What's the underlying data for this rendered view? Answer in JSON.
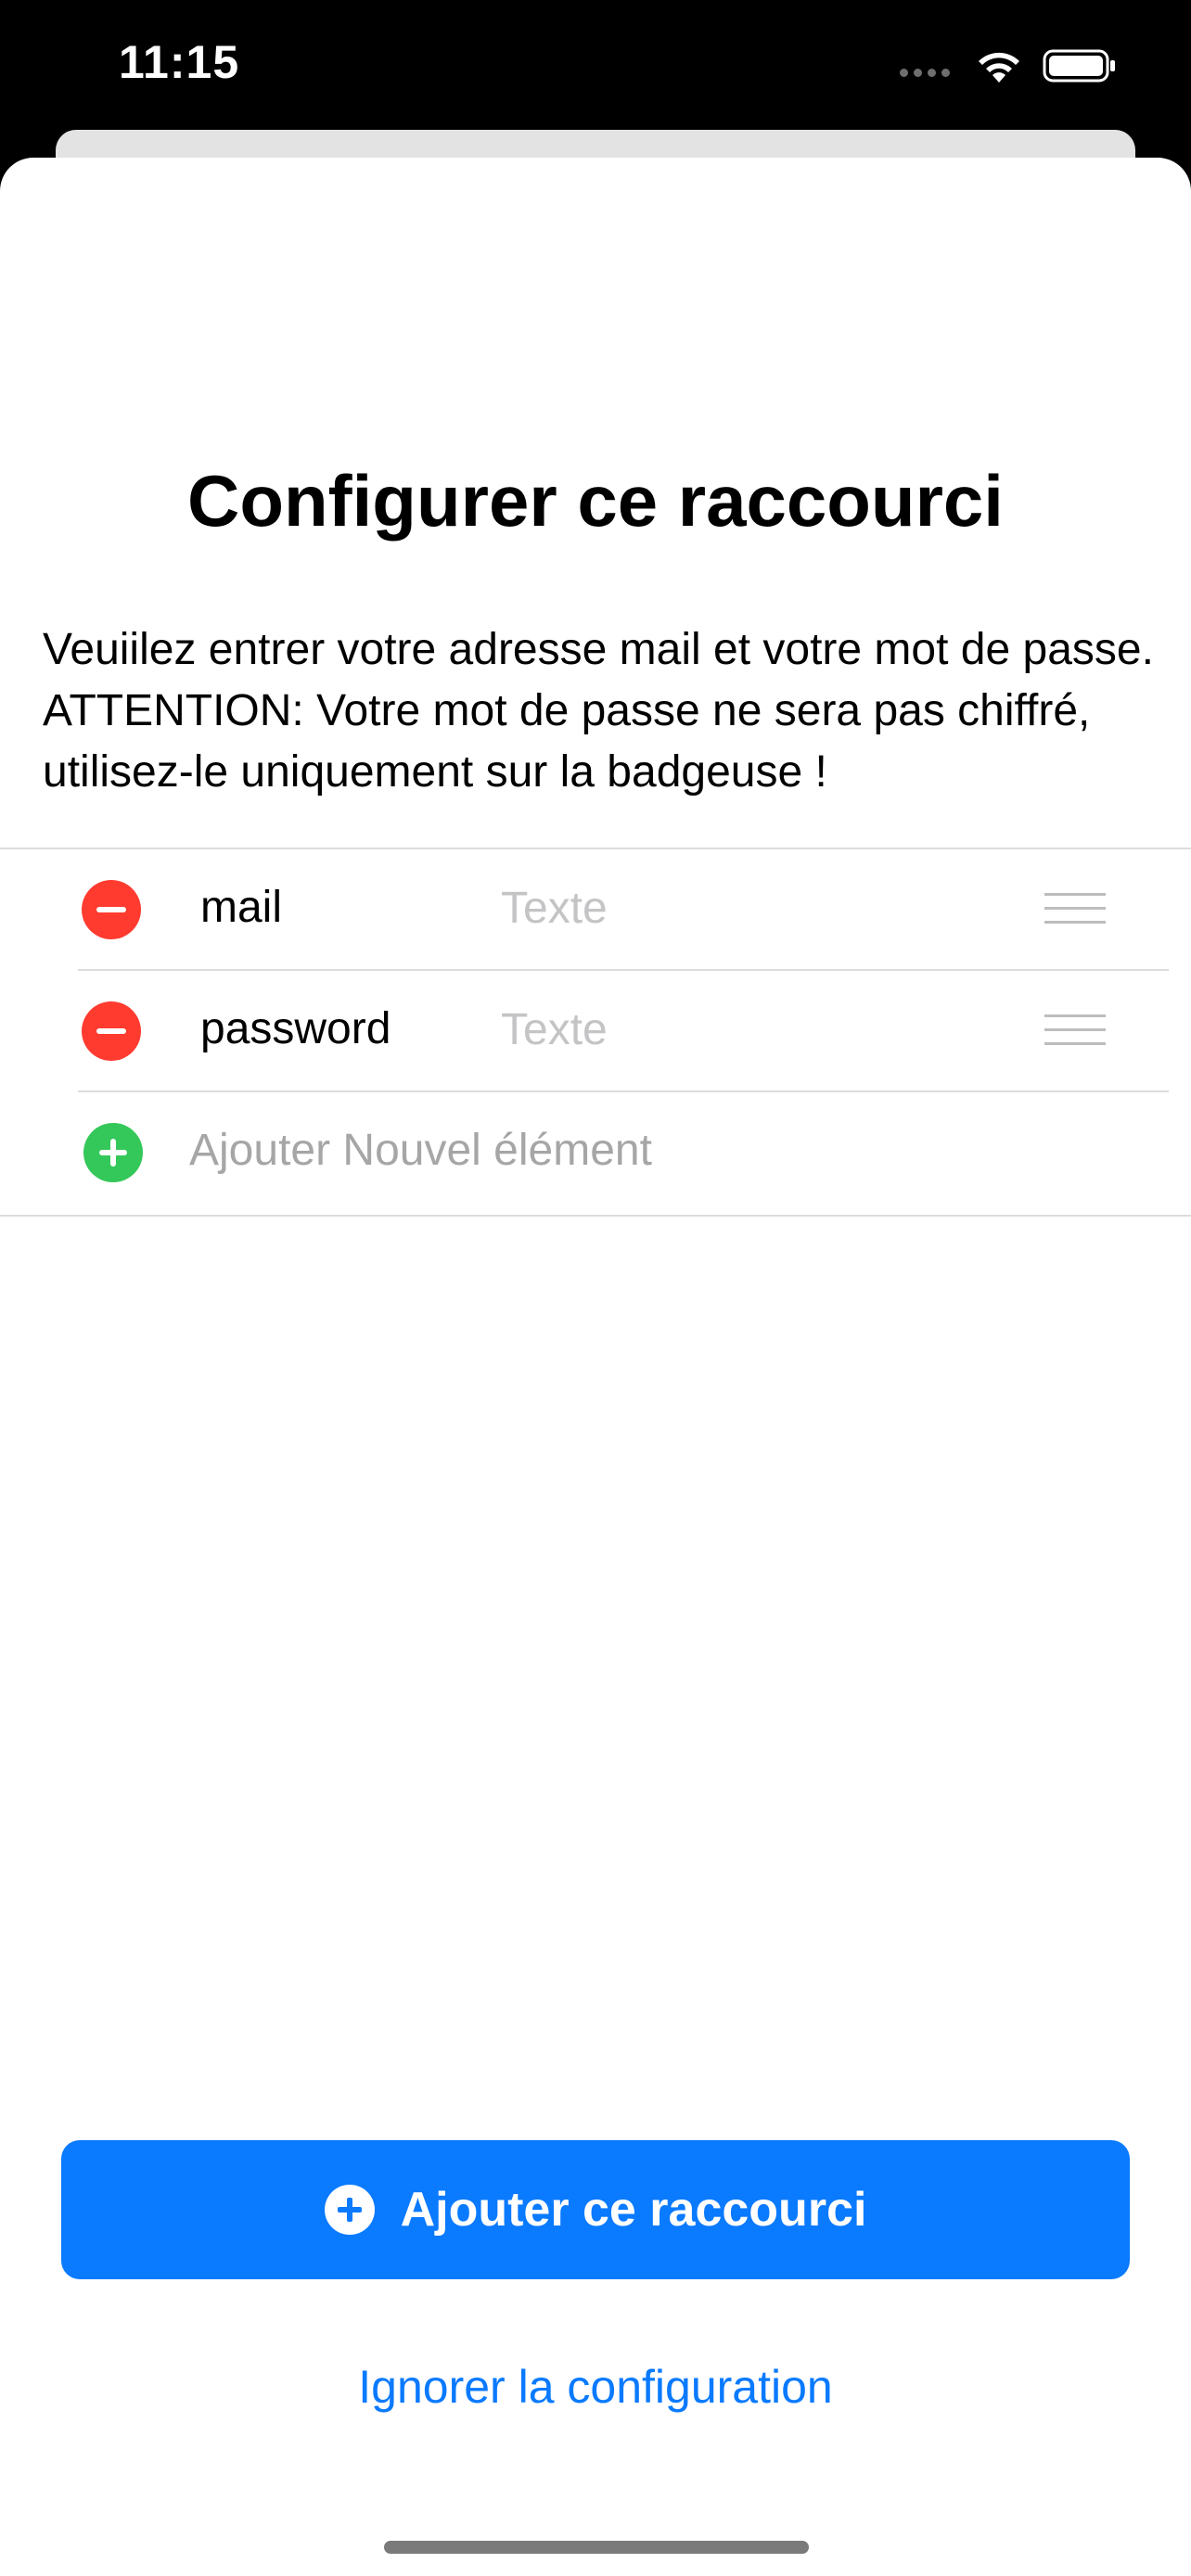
{
  "status_bar": {
    "time": "11:15",
    "icons": [
      "signal-dots-icon",
      "wifi-icon",
      "battery-icon"
    ]
  },
  "sheet": {
    "title": "Configurer ce raccourci",
    "description": "Veuiilez entrer votre adresse mail et votre mot de passe. ATTENTION: Votre mot de passe ne sera pas chiffré, utilisez-le uniquement sur la badgeuse !"
  },
  "fields": [
    {
      "label": "mail",
      "value": "",
      "placeholder": "Texte"
    },
    {
      "label": "password",
      "value": "",
      "placeholder": "Texte"
    }
  ],
  "add_row": {
    "label": "Ajouter Nouvel élément"
  },
  "actions": {
    "primary_label": "Ajouter ce raccourci",
    "secondary_label": "Ignorer la configuration"
  },
  "colors": {
    "accent": "#0a7aff",
    "remove": "#ff3b30",
    "add": "#34c759"
  }
}
